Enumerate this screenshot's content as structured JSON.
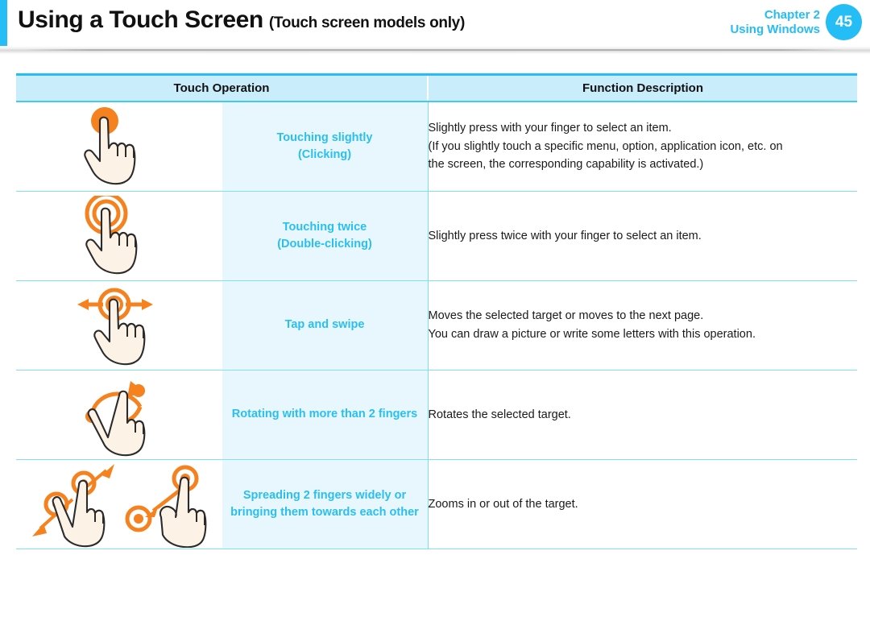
{
  "header": {
    "title": "Using a Touch Screen",
    "subtitle": "(Touch screen models only)",
    "chapter": "Chapter 2",
    "section": "Using Windows",
    "page_number": "45",
    "accent_color": "#25bdf5"
  },
  "table": {
    "columns": [
      "Touch Operation",
      "Function Description"
    ],
    "header_bg": "#c9edfb",
    "label_bg": "#e8f7fd",
    "label_color": "#29bff2",
    "border_color": "#7fe0f7",
    "icon_color": "#f6821f",
    "rows": [
      {
        "icon": "touch-tap-icon",
        "label_line1": "Touching slightly",
        "label_line2": "(Clicking)",
        "desc_line1": "Slightly press with your finger to select an item.",
        "desc_line2": "(If you slightly touch a specific menu, option, application icon, etc. on",
        "desc_line3": "the screen, the corresponding capability is activated.)"
      },
      {
        "icon": "touch-double-tap-icon",
        "label_line1": "Touching twice",
        "label_line2": "(Double-clicking)",
        "desc_line1": "Slightly press twice with your finger to select an item.",
        "desc_line2": "",
        "desc_line3": ""
      },
      {
        "icon": "touch-swipe-icon",
        "label_line1": "Tap and swipe",
        "label_line2": "",
        "desc_line1": "Moves the selected target or moves to the next page.",
        "desc_line2": "You can draw a picture or write some letters with this operation.",
        "desc_line3": ""
      },
      {
        "icon": "touch-rotate-icon",
        "label_line1": "Rotating with more than 2 fingers",
        "label_line2": "",
        "desc_line1": "Rotates the selected target.",
        "desc_line2": "",
        "desc_line3": ""
      },
      {
        "icon": "touch-pinch-zoom-icon",
        "label_line1": "Spreading 2 fingers widely or",
        "label_line2": "bringing them towards each other",
        "desc_line1": "Zooms in or out of the target.",
        "desc_line2": "",
        "desc_line3": ""
      }
    ]
  }
}
